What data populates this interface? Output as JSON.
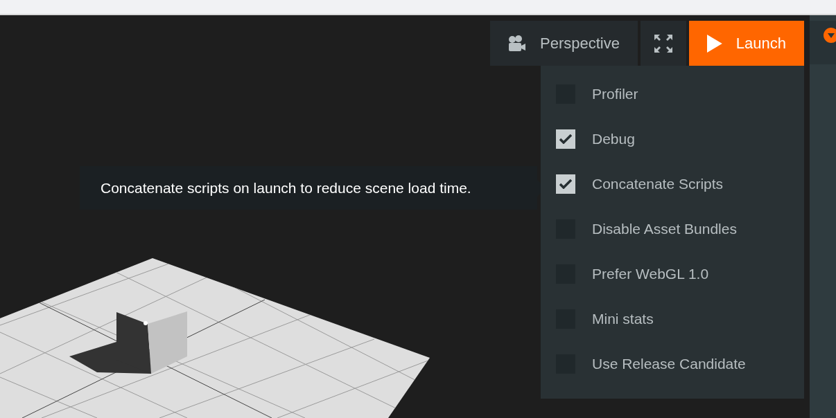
{
  "toolbar": {
    "buttons": [
      {
        "kind": "camera",
        "label": "Perspective"
      },
      {
        "kind": "expand"
      },
      {
        "kind": "launch",
        "label": "Launch"
      }
    ]
  },
  "launch_menu": {
    "items": [
      {
        "label": "Profiler",
        "checked": false
      },
      {
        "label": "Debug",
        "checked": true
      },
      {
        "label": "Concatenate Scripts",
        "checked": true
      },
      {
        "label": "Disable Asset Bundles",
        "checked": false
      },
      {
        "label": "Prefer WebGL 1.0",
        "checked": false
      },
      {
        "label": "Mini stats",
        "checked": false
      },
      {
        "label": "Use Release Candidate",
        "checked": false
      }
    ]
  },
  "tooltip": {
    "text": "Concatenate scripts on launch to reduce scene load time."
  }
}
